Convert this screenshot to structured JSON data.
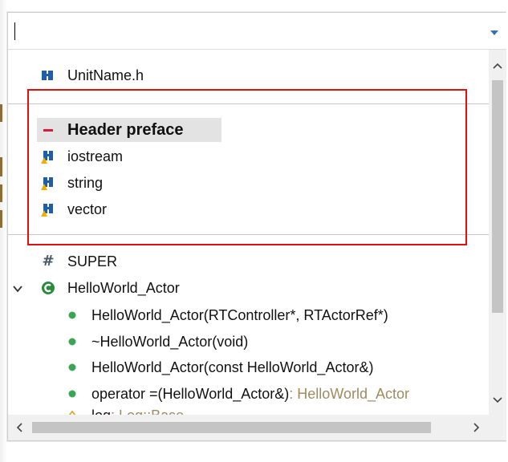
{
  "filter": {
    "value": "",
    "placeholder": ""
  },
  "items": [
    {
      "label": "UnitName.h",
      "type": "",
      "icon": "header-file-icon"
    },
    {
      "label": "Header preface",
      "type": "",
      "icon": "minus-icon"
    },
    {
      "label": "iostream",
      "type": "",
      "icon": "include-icon"
    },
    {
      "label": "string",
      "type": "",
      "icon": "include-icon"
    },
    {
      "label": "vector",
      "type": "",
      "icon": "include-icon"
    },
    {
      "label": "SUPER",
      "type": "",
      "icon": "macro-icon"
    },
    {
      "label": "HelloWorld_Actor",
      "type": "",
      "icon": "class-icon"
    },
    {
      "label": "HelloWorld_Actor(RTController*, RTActorRef*)",
      "type": "",
      "icon": "public-method-icon"
    },
    {
      "label": "~HelloWorld_Actor(void)",
      "type": "",
      "icon": "public-method-icon"
    },
    {
      "label": "HelloWorld_Actor(const HelloWorld_Actor&)",
      "type": "",
      "icon": "public-method-icon"
    },
    {
      "label": "operator =(HelloWorld_Actor&)",
      "type": " : HelloWorld_Actor",
      "icon": "public-method-icon"
    },
    {
      "label": "log",
      "type": " : Log::Base",
      "icon": "field-icon"
    }
  ],
  "colors": {
    "highlight_border": "#e01010",
    "type_text": "#a08a5e",
    "method_green": "#3aa655",
    "class_green": "#2b8a3e",
    "minus_red": "#d81b3c"
  }
}
